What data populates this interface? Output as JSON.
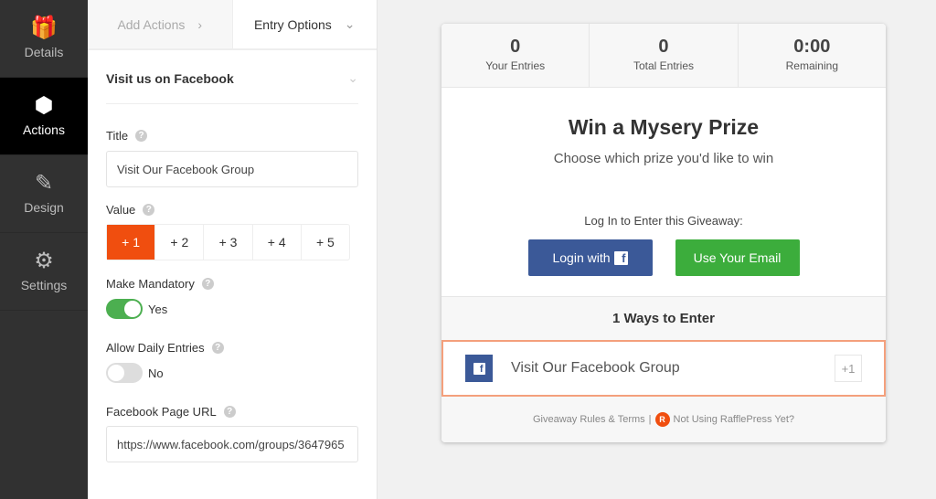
{
  "sidebar": {
    "items": [
      {
        "label": "Details",
        "icon": "gift-icon"
      },
      {
        "label": "Actions",
        "icon": "cubes-icon",
        "active": true
      },
      {
        "label": "Design",
        "icon": "pencil-ruler-icon"
      },
      {
        "label": "Settings",
        "icon": "gear-icon"
      }
    ]
  },
  "tabs": {
    "add_actions": "Add Actions",
    "entry_options": "Entry Options"
  },
  "action": {
    "header": "Visit us on Facebook",
    "title_label": "Title",
    "title_value": "Visit Our Facebook Group",
    "value_label": "Value",
    "values": [
      "+ 1",
      "+ 2",
      "+ 3",
      "+ 4",
      "+ 5"
    ],
    "selected_value": "+ 1",
    "mandatory_label": "Make Mandatory",
    "mandatory_state": "Yes",
    "daily_label": "Allow Daily Entries",
    "daily_state": "No",
    "url_label": "Facebook Page URL",
    "url_value": "https://www.facebook.com/groups/3647965"
  },
  "preview": {
    "stats": [
      {
        "value": "0",
        "label": "Your Entries"
      },
      {
        "value": "0",
        "label": "Total Entries"
      },
      {
        "value": "0:00",
        "label": "Remaining"
      }
    ],
    "title": "Win a Mysery Prize",
    "subtitle": "Choose which prize you'd like to win",
    "login_prompt": "Log In to Enter this Giveaway:",
    "login_fb": "Login with",
    "login_email": "Use Your Email",
    "ways": "1 Ways to Enter",
    "entry_label": "Visit Our Facebook Group",
    "entry_points": "+1",
    "rules": "Giveaway Rules & Terms",
    "sep": "|",
    "promo": "Not Using RafflePress Yet?"
  },
  "colors": {
    "accent": "#f04e0f",
    "facebook": "#3b5998",
    "green": "#3cad3c"
  }
}
